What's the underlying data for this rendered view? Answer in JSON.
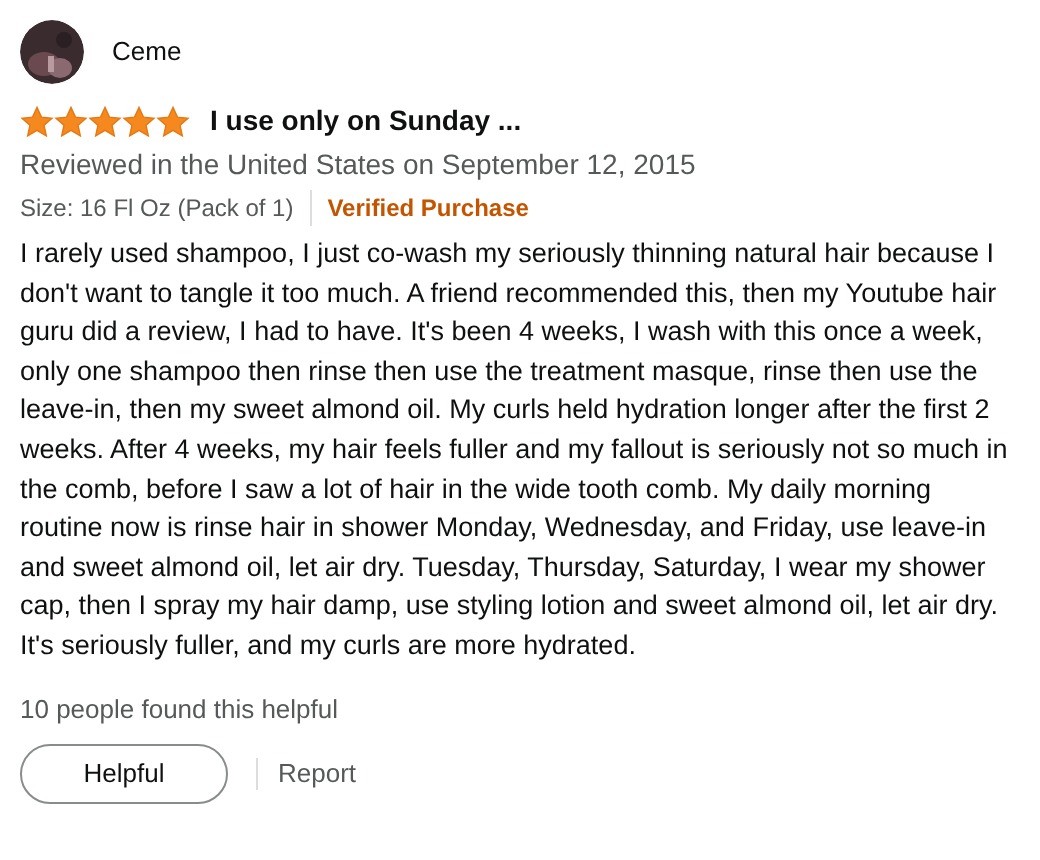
{
  "reviewer": {
    "name": "Ceme"
  },
  "review": {
    "stars": 5,
    "title": "I use only on Sunday ...",
    "meta": "Reviewed in the United States on September 12, 2015",
    "size": "Size: 16 Fl Oz (Pack of 1)",
    "badge": "Verified Purchase",
    "body": "I rarely used shampoo, I just co-wash my seriously thinning natural hair because I don't want to tangle it too much. A friend recommended this, then my Youtube hair guru did a review, I had to have. It's been 4 weeks, I wash with this once a week, only one shampoo then rinse then use the treatment masque, rinse then use the leave-in, then my sweet almond oil. My curls held hydration longer after the first 2 weeks. After 4 weeks, my hair feels fuller and my fallout is seriously not so much in the comb, before I saw a lot of hair in the wide tooth comb. My daily morning routine now is rinse hair in shower Monday, Wednesday, and Friday, use leave-in and sweet almond oil, let air dry. Tuesday, Thursday, Saturday, I wear my shower cap, then I spray my hair damp, use styling lotion and sweet almond oil, let air dry. It's seriously fuller, and my curls are more hydrated.",
    "helpful_count": "10 people found this helpful"
  },
  "actions": {
    "helpful": "Helpful",
    "report": "Report"
  }
}
